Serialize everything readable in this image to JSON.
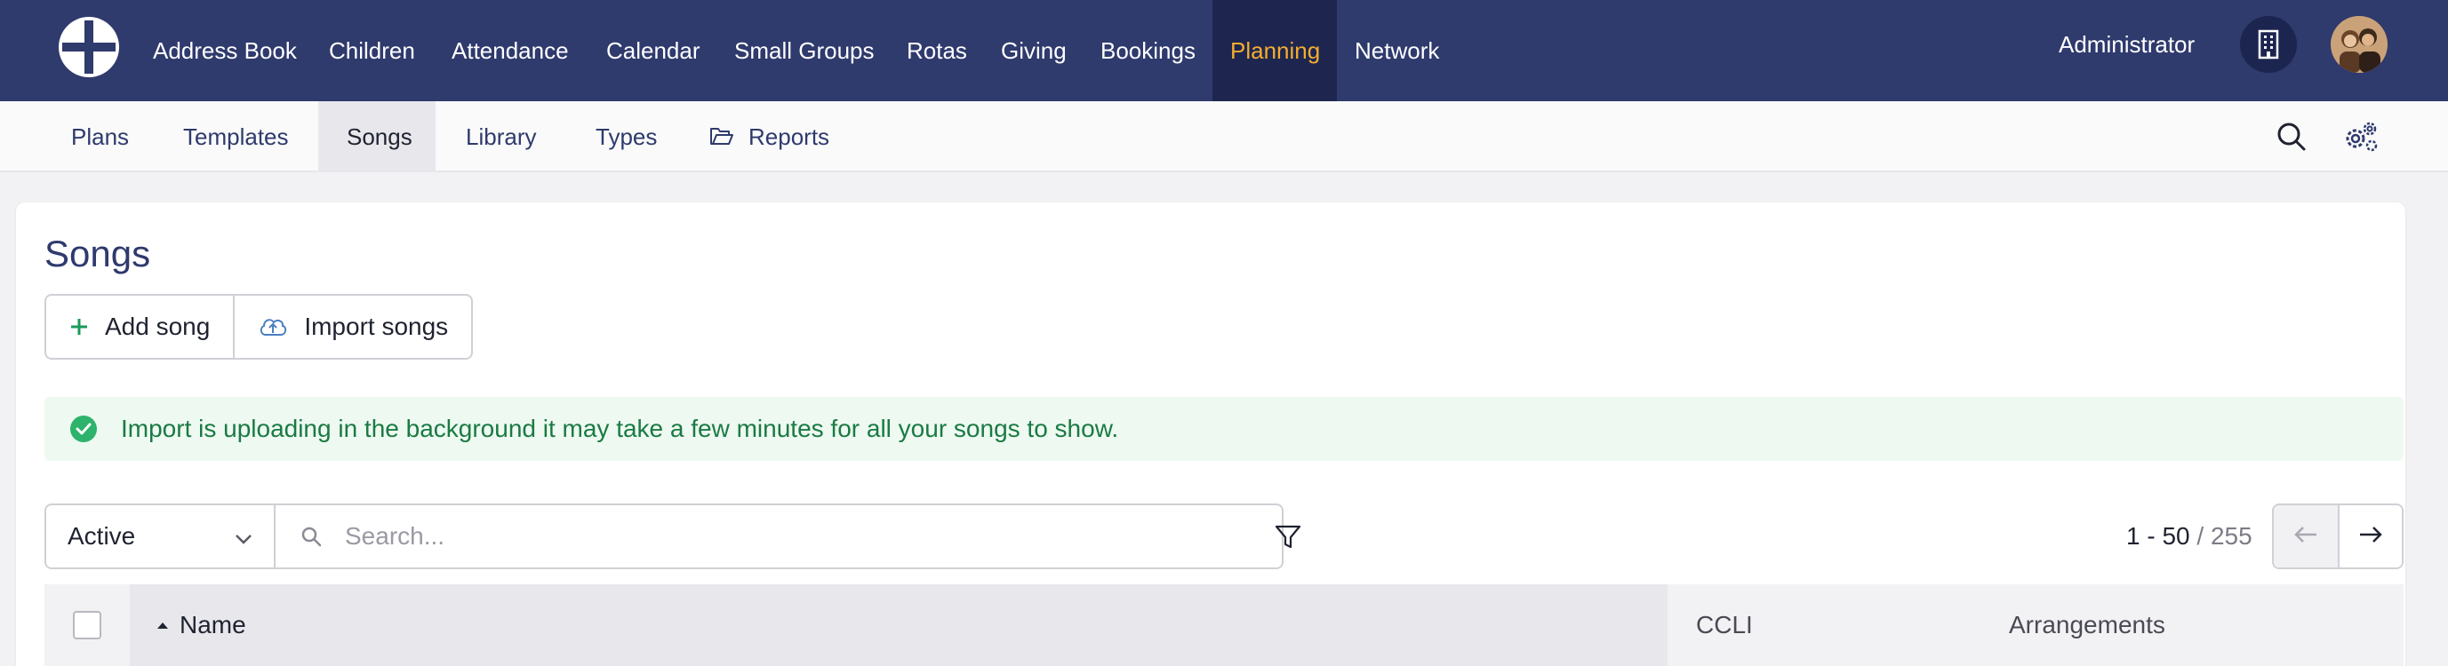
{
  "topnav": {
    "items": [
      {
        "label": "Address Book"
      },
      {
        "label": "Children"
      },
      {
        "label": "Attendance"
      },
      {
        "label": "Calendar"
      },
      {
        "label": "Small Groups"
      },
      {
        "label": "Rotas"
      },
      {
        "label": "Giving"
      },
      {
        "label": "Bookings"
      },
      {
        "label": "Planning"
      },
      {
        "label": "Network"
      }
    ],
    "active": "Planning",
    "user": "Administrator",
    "colors": {
      "bar": "#2f3a6d",
      "active_bg": "#1e2650",
      "active_text": "#f5ad2e"
    }
  },
  "subnav": {
    "items": [
      {
        "label": "Plans"
      },
      {
        "label": "Templates"
      },
      {
        "label": "Songs"
      },
      {
        "label": "Library"
      },
      {
        "label": "Types"
      },
      {
        "label": "Reports",
        "icon": "folder-open-icon"
      }
    ],
    "active": "Songs",
    "right_icons": [
      "search-icon",
      "settings-gears-icon"
    ]
  },
  "page": {
    "title": "Songs",
    "buttons": {
      "add_song": "Add song",
      "import_songs": "Import songs"
    },
    "alert": {
      "text": "Import is uploading in the background it may take a few minutes for all your songs to show.",
      "icon": "check-circle-icon",
      "color": "#1b7a43"
    },
    "filters": {
      "status_value": "Active",
      "search_placeholder": "Search..."
    },
    "pagination": {
      "range": "1 - 50",
      "total": "/ 255"
    },
    "table": {
      "columns": [
        "Name",
        "CCLI",
        "Arrangements"
      ],
      "sorted_by": "Name",
      "sort_direction": "ascending"
    }
  }
}
